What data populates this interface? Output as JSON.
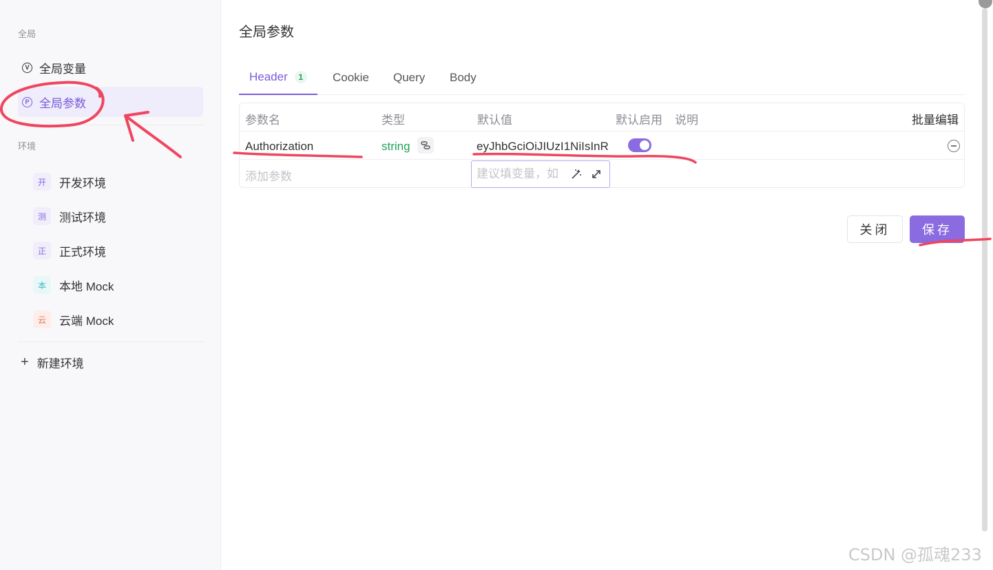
{
  "sidebar": {
    "section_global": "全局",
    "items": [
      {
        "label": "全局变量",
        "icon": "v-circle-icon",
        "icon_glyph": "V"
      },
      {
        "label": "全局参数",
        "icon": "p-circle-icon",
        "icon_glyph": "P",
        "active": true
      }
    ],
    "section_env": "环境",
    "environments": [
      {
        "badge": "开",
        "label": "开发环境",
        "badge_color": "#8a6be0"
      },
      {
        "badge": "测",
        "label": "测试环境",
        "badge_color": "#8a6be0"
      },
      {
        "badge": "正",
        "label": "正式环境",
        "badge_color": "#8a6be0"
      },
      {
        "badge": "本",
        "label": "本地 Mock",
        "badge_color": "#3bb8c3"
      },
      {
        "badge": "云",
        "label": "云端 Mock",
        "badge_color": "#e8735a"
      }
    ],
    "new_env_label": "新建环境",
    "new_env_icon": "plus-icon"
  },
  "main": {
    "title": "全局参数",
    "tabs": [
      {
        "label": "Header",
        "count": "1",
        "active": true
      },
      {
        "label": "Cookie"
      },
      {
        "label": "Query"
      },
      {
        "label": "Body"
      }
    ],
    "table": {
      "headers": {
        "name": "参数名",
        "type": "类型",
        "default_value": "默认值",
        "enabled": "默认启用",
        "description": "说明",
        "bulk_edit": "批量编辑"
      },
      "rows": [
        {
          "name": "Authorization",
          "type": "string",
          "type_icon": "link-icon",
          "default_value": "eyJhbGciOiJIUzI1NiIsInR",
          "enabled": true,
          "description": ""
        }
      ],
      "add_placeholder": "添加参数",
      "value_placeholder": "建议填变量，如",
      "value_icons": [
        "magic-wand-icon",
        "expand-icon"
      ]
    },
    "buttons": {
      "close": "关闭",
      "save": "保存"
    }
  },
  "watermark": "CSDN @孤魂233",
  "colors": {
    "accent": "#8a6be0",
    "type_green": "#22a35a",
    "annotation_red": "#f0455f"
  }
}
